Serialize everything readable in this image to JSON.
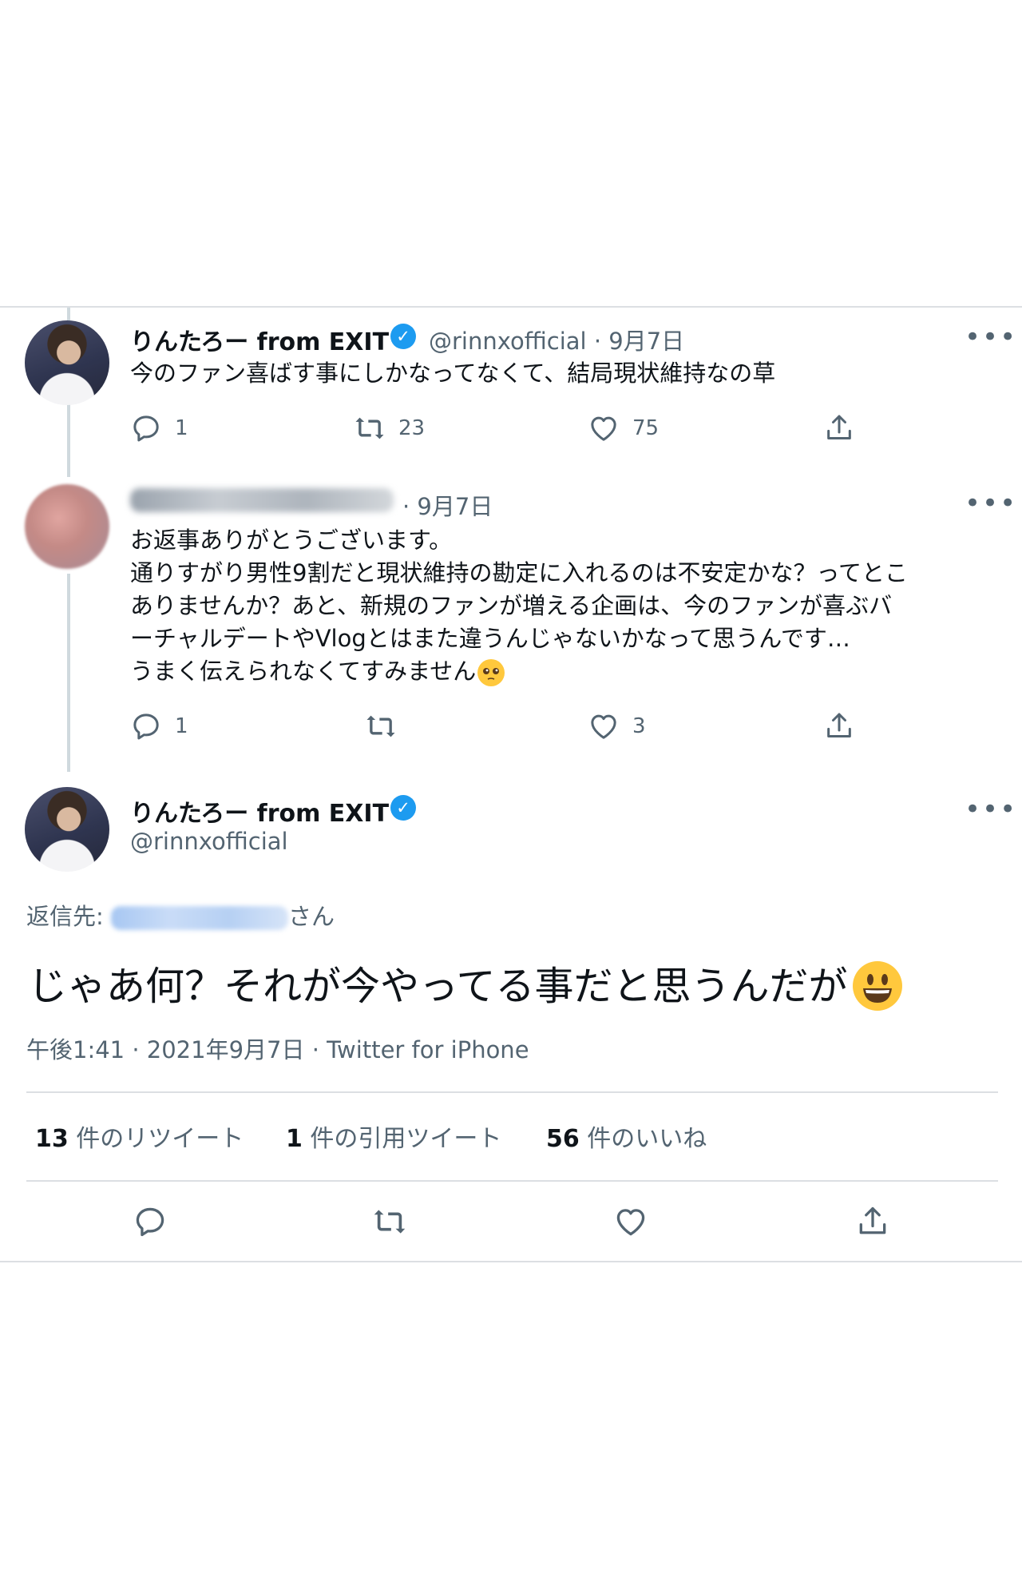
{
  "tweet1": {
    "display_name": "りんたろー from EXIT",
    "handle_date": "@rinnxofficial · 9月7日",
    "text": "今のファン喜ばす事にしかなってなくて、結局現状維持なの草",
    "replies": "1",
    "retweets": "23",
    "likes": "75"
  },
  "tweet2": {
    "date": "· 9月7日",
    "lines": [
      "お返事ありがとうございます。",
      "通りすがり男性9割だと現状維持の勘定に入れるのは不安定かな？ってとこ",
      "ありませんか？あと、新規のファンが増える企画は、今のファンが喜ぶバ",
      "ーチャルデートやVlogとはまた違うんじゃないかなって思うんです…",
      "うまく伝えられなくてすみません"
    ],
    "replies": "1",
    "likes": "3"
  },
  "tweet3": {
    "display_name": "りんたろー from EXIT",
    "handle": "@rinnxofficial",
    "reply_to_prefix": "返信先:",
    "reply_to_suffix": "さん",
    "text": "じゃあ何？それが今やってる事だと思うんだが",
    "meta": "午後1:41 · 2021年9月7日 · Twitter for iPhone",
    "retweet_count": "13",
    "retweet_label": " 件のリツイート",
    "quote_count": "1",
    "quote_label": " 件の引用ツイート",
    "like_count": "56",
    "like_label": " 件のいいね"
  },
  "colors": {
    "accent": "#1d9bf0",
    "text": "#0f1419",
    "muted": "#536471",
    "divider": "#dcdfe3"
  },
  "icons": [
    "reply-icon",
    "retweet-icon",
    "like-icon",
    "share-icon",
    "more-icon",
    "verified-icon"
  ]
}
